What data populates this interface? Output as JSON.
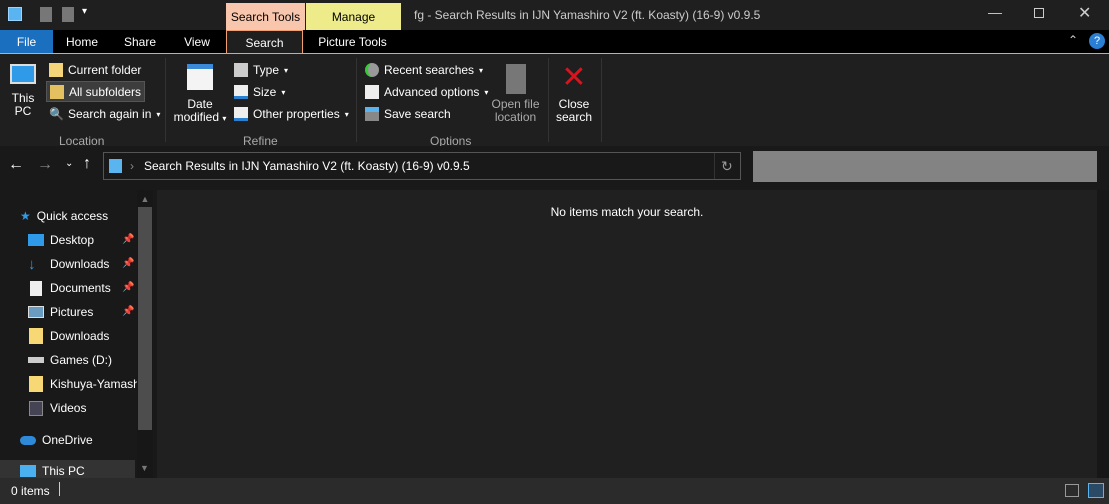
{
  "title": "fg - Search Results in IJN Yamashiro V2 (ft. Koasty) (16-9) v0.9.5",
  "context_tabs": {
    "search_tools": "Search Tools",
    "manage": "Manage"
  },
  "tabs": [
    "File",
    "Home",
    "Share",
    "View",
    "Search",
    "Picture Tools"
  ],
  "ribbon": {
    "location": {
      "this_pc": "This PC",
      "current_folder": "Current folder",
      "all_subfolders": "All subfolders",
      "search_again": "Search again in",
      "label": "Location"
    },
    "refine": {
      "date_modified": "Date modified",
      "type": "Type",
      "size": "Size",
      "other": "Other properties",
      "label": "Refine"
    },
    "options": {
      "recent": "Recent searches",
      "advanced": "Advanced options",
      "save": "Save search",
      "open_location": "Open file location",
      "close": "Close search",
      "label": "Options"
    }
  },
  "address": {
    "path": "Search Results in IJN Yamashiro V2 (ft. Koasty) (16-9) v0.9.5",
    "search_value": ""
  },
  "nav": {
    "quick_access": "Quick access",
    "items": [
      {
        "label": "Desktop",
        "pinned": true
      },
      {
        "label": "Downloads",
        "pinned": true
      },
      {
        "label": "Documents",
        "pinned": true
      },
      {
        "label": "Pictures",
        "pinned": true
      },
      {
        "label": "Downloads",
        "pinned": false
      },
      {
        "label": "Games (D:)",
        "pinned": false
      },
      {
        "label": "Kishuya-Yamash",
        "pinned": false
      },
      {
        "label": "Videos",
        "pinned": false
      }
    ],
    "onedrive": "OneDrive",
    "this_pc": "This PC"
  },
  "content": {
    "empty_message": "No items match your search."
  },
  "status": {
    "count": "0 items"
  },
  "colors": {
    "search_tools": "#f8c6ad",
    "manage": "#eeec8a",
    "file_tab": "#1a6fbf",
    "accent_border": "#f0a070"
  }
}
